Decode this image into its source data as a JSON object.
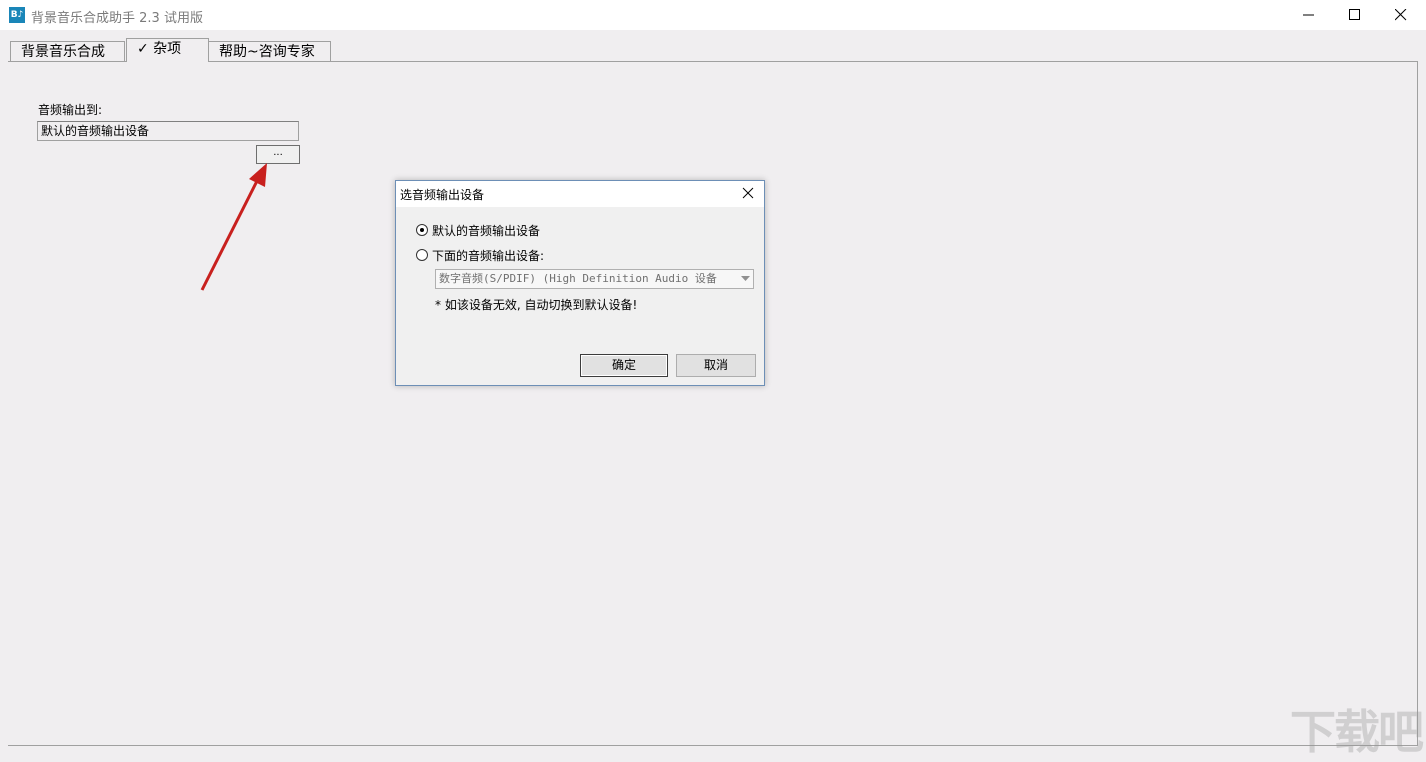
{
  "window": {
    "icon_text": "B♪",
    "title": "背景音乐合成助手 2.3 试用版"
  },
  "tabs": [
    {
      "label": "背景音乐合成"
    },
    {
      "label": "✓ 杂项"
    },
    {
      "label": "帮助~咨询专家"
    }
  ],
  "misc": {
    "output_label": "音频输出到:",
    "output_value": "默认的音频输出设备",
    "browse_label": "..."
  },
  "dialog": {
    "title": "选音频输出设备",
    "option_default": "默认的音频输出设备",
    "option_custom": "下面的音频输出设备:",
    "device_select": "数字音频(S/PDIF) (High Definition Audio 设备",
    "note": "* 如该设备无效, 自动切换到默认设备!",
    "ok_label": "确定",
    "cancel_label": "取消"
  },
  "watermark": "下载吧",
  "colors": {
    "arrow": "#c8201e",
    "dialog_border": "#6d8fb6",
    "app_icon": "#1a86b8"
  }
}
